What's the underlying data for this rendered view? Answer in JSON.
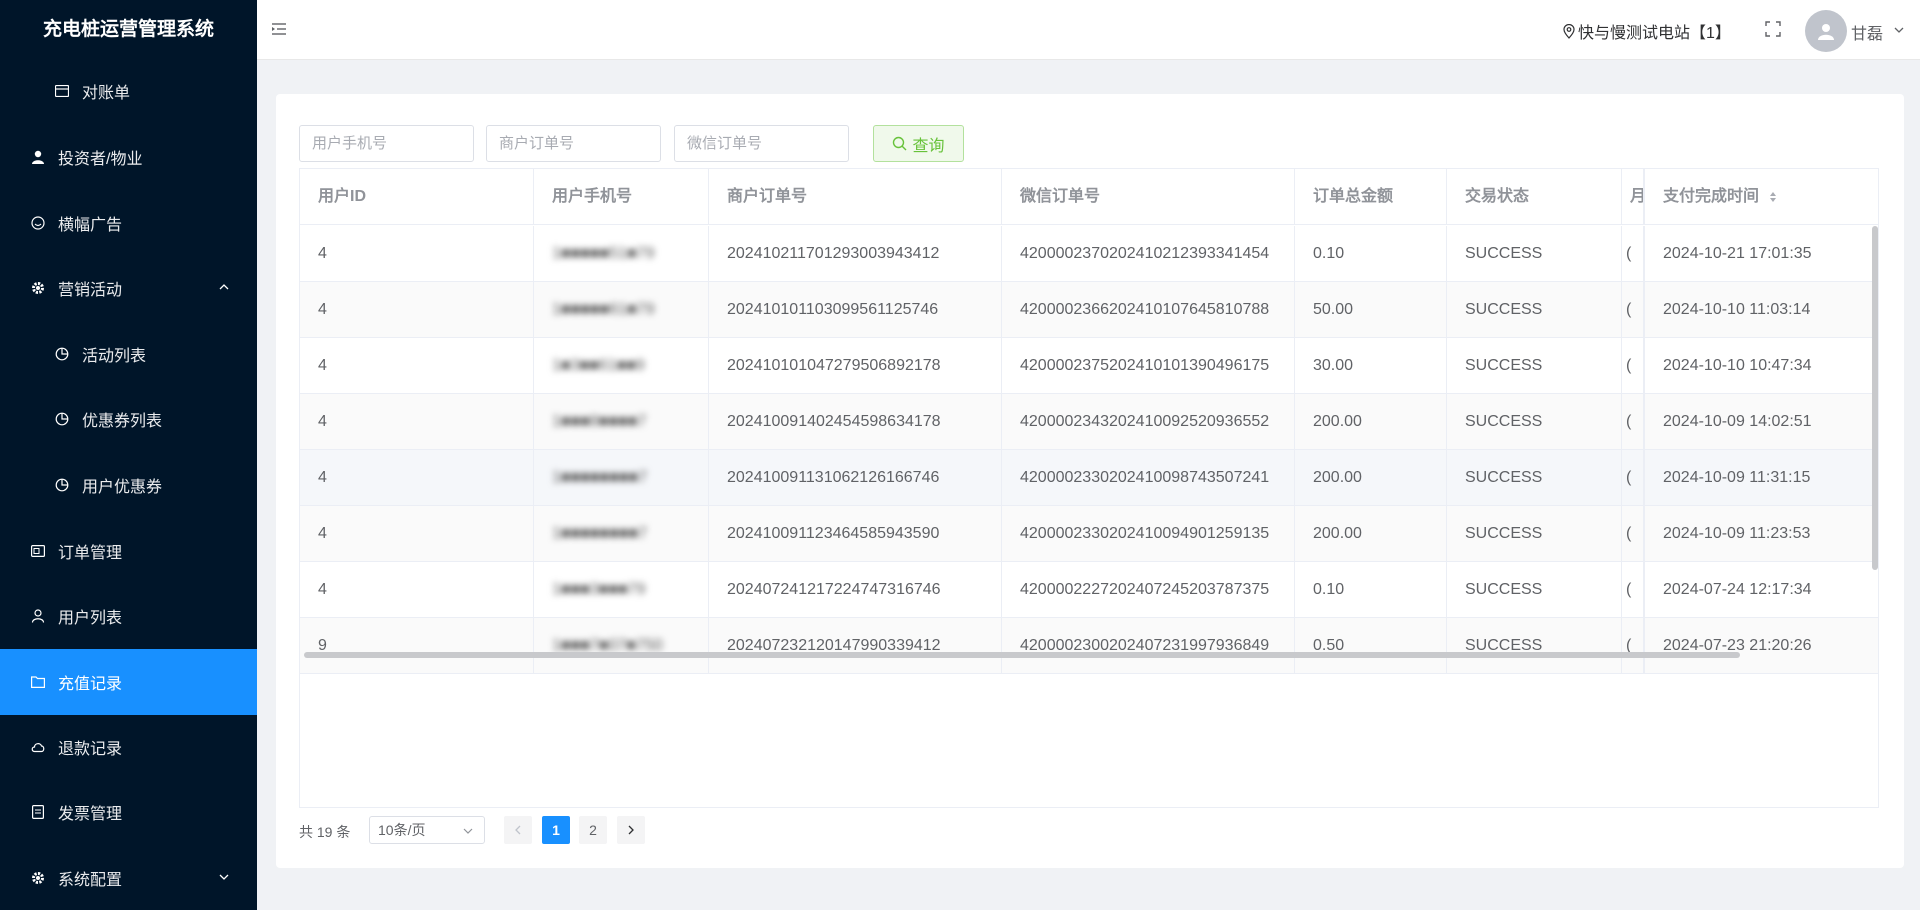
{
  "app": {
    "title": "充电桩运营管理系统"
  },
  "sidebar": {
    "items": [
      {
        "label": "对账单",
        "icon": "card-icon",
        "sub": true
      },
      {
        "label": "投资者/物业",
        "icon": "user-icon",
        "sub": false
      },
      {
        "label": "横幅广告",
        "icon": "smile-icon",
        "sub": false
      },
      {
        "label": "营销活动",
        "icon": "gear-icon",
        "sub": false,
        "expanded": true
      },
      {
        "label": "活动列表",
        "icon": "pie-icon",
        "sub": true
      },
      {
        "label": "优惠券列表",
        "icon": "pie-icon",
        "sub": true
      },
      {
        "label": "用户优惠券",
        "icon": "pie-icon",
        "sub": true
      },
      {
        "label": "订单管理",
        "icon": "ticket-icon",
        "sub": false
      },
      {
        "label": "用户列表",
        "icon": "person-icon",
        "sub": false
      },
      {
        "label": "充值记录",
        "icon": "folder-icon",
        "sub": false,
        "active": true
      },
      {
        "label": "退款记录",
        "icon": "cloud-icon",
        "sub": false
      },
      {
        "label": "发票管理",
        "icon": "doc-icon",
        "sub": false
      },
      {
        "label": "系统配置",
        "icon": "gear-icon",
        "sub": false,
        "collapsed": true
      }
    ]
  },
  "header": {
    "station": "快与慢测试电站【1】",
    "username": "甘磊"
  },
  "search": {
    "phone_placeholder": "用户手机号",
    "merchant_order_placeholder": "商户订单号",
    "wechat_order_placeholder": "微信订单号",
    "query_label": "查询"
  },
  "table": {
    "columns": [
      "用户ID",
      "用户手机号",
      "商户订单号",
      "微信订单号",
      "订单总金额",
      "交易状态",
      "月",
      "支付完成时间"
    ],
    "rows": [
      {
        "user_id": "4",
        "phone": "1■■■■■51■79",
        "merchant_order": "20241021170129300394341­2",
        "wechat_order": "4200002370202410212393341454",
        "amount": "0.10",
        "status": "SUCCESS",
        "partial": "(",
        "paid_at": "2024-10-21 17:01:35"
      },
      {
        "user_id": "4",
        "phone": "1■■■■■61■79",
        "merchant_order": "20241010110309956112574­6",
        "wechat_order": "4200002366202410107645810788",
        "amount": "50.00",
        "status": "SUCCESS",
        "partial": "(",
        "paid_at": "2024-10-10 11:03:14"
      },
      {
        "user_id": "4",
        "phone": "1■3■■61■■9",
        "merchant_order": "20241010104727950689217­8",
        "wechat_order": "4200002375202410101390496175",
        "amount": "30.00",
        "status": "SUCCESS",
        "partial": "(",
        "paid_at": "2024-10-10 10:47:34"
      },
      {
        "user_id": "4",
        "phone": "1■■■8■■■■7",
        "merchant_order": "20241009140245459863417­8",
        "wechat_order": "4200002343202410092520936552",
        "amount": "200.00",
        "status": "SUCCESS",
        "partial": "(",
        "paid_at": "2024-10-09 14:02:51"
      },
      {
        "user_id": "4",
        "phone": "1■■■■■■■■7",
        "merchant_order": "20241009113106212616674­6",
        "wechat_order": "4200002330202410098743507241",
        "amount": "200.00",
        "status": "SUCCESS",
        "partial": "(",
        "paid_at": "2024-10-09 11:31:15"
      },
      {
        "user_id": "4",
        "phone": "1■■■■■■■■7",
        "merchant_order": "20241009112346458594359­0",
        "wechat_order": "4200002330202410094901259135",
        "amount": "200.00",
        "status": "SUCCESS",
        "partial": "(",
        "paid_at": "2024-10-09 11:23:53"
      },
      {
        "user_id": "4",
        "phone": "1■■■3■■■79",
        "merchant_order": "20240724121722474731674­6",
        "wechat_order": "4200002227202407245203787375",
        "amount": "0.10",
        "status": "SUCCESS",
        "partial": "(",
        "paid_at": "2024-07-24 12:17:34"
      },
      {
        "user_id": "9",
        "phone": "1■■■7■07■750",
        "merchant_order": "20240723212014799033941­2",
        "wechat_order": "4200002300202407231997936849",
        "amount": "0.50",
        "status": "SUCCESS",
        "partial": "(",
        "paid_at": "2024-07-23 21:20:26"
      }
    ]
  },
  "pagination": {
    "total": "共 19 条",
    "page_size": "10条/页",
    "pages": [
      "1",
      "2"
    ],
    "current": "1"
  },
  "colors": {
    "sidebar_bg": "#001529",
    "active": "#1890ff",
    "query_green": "#67c23a"
  }
}
